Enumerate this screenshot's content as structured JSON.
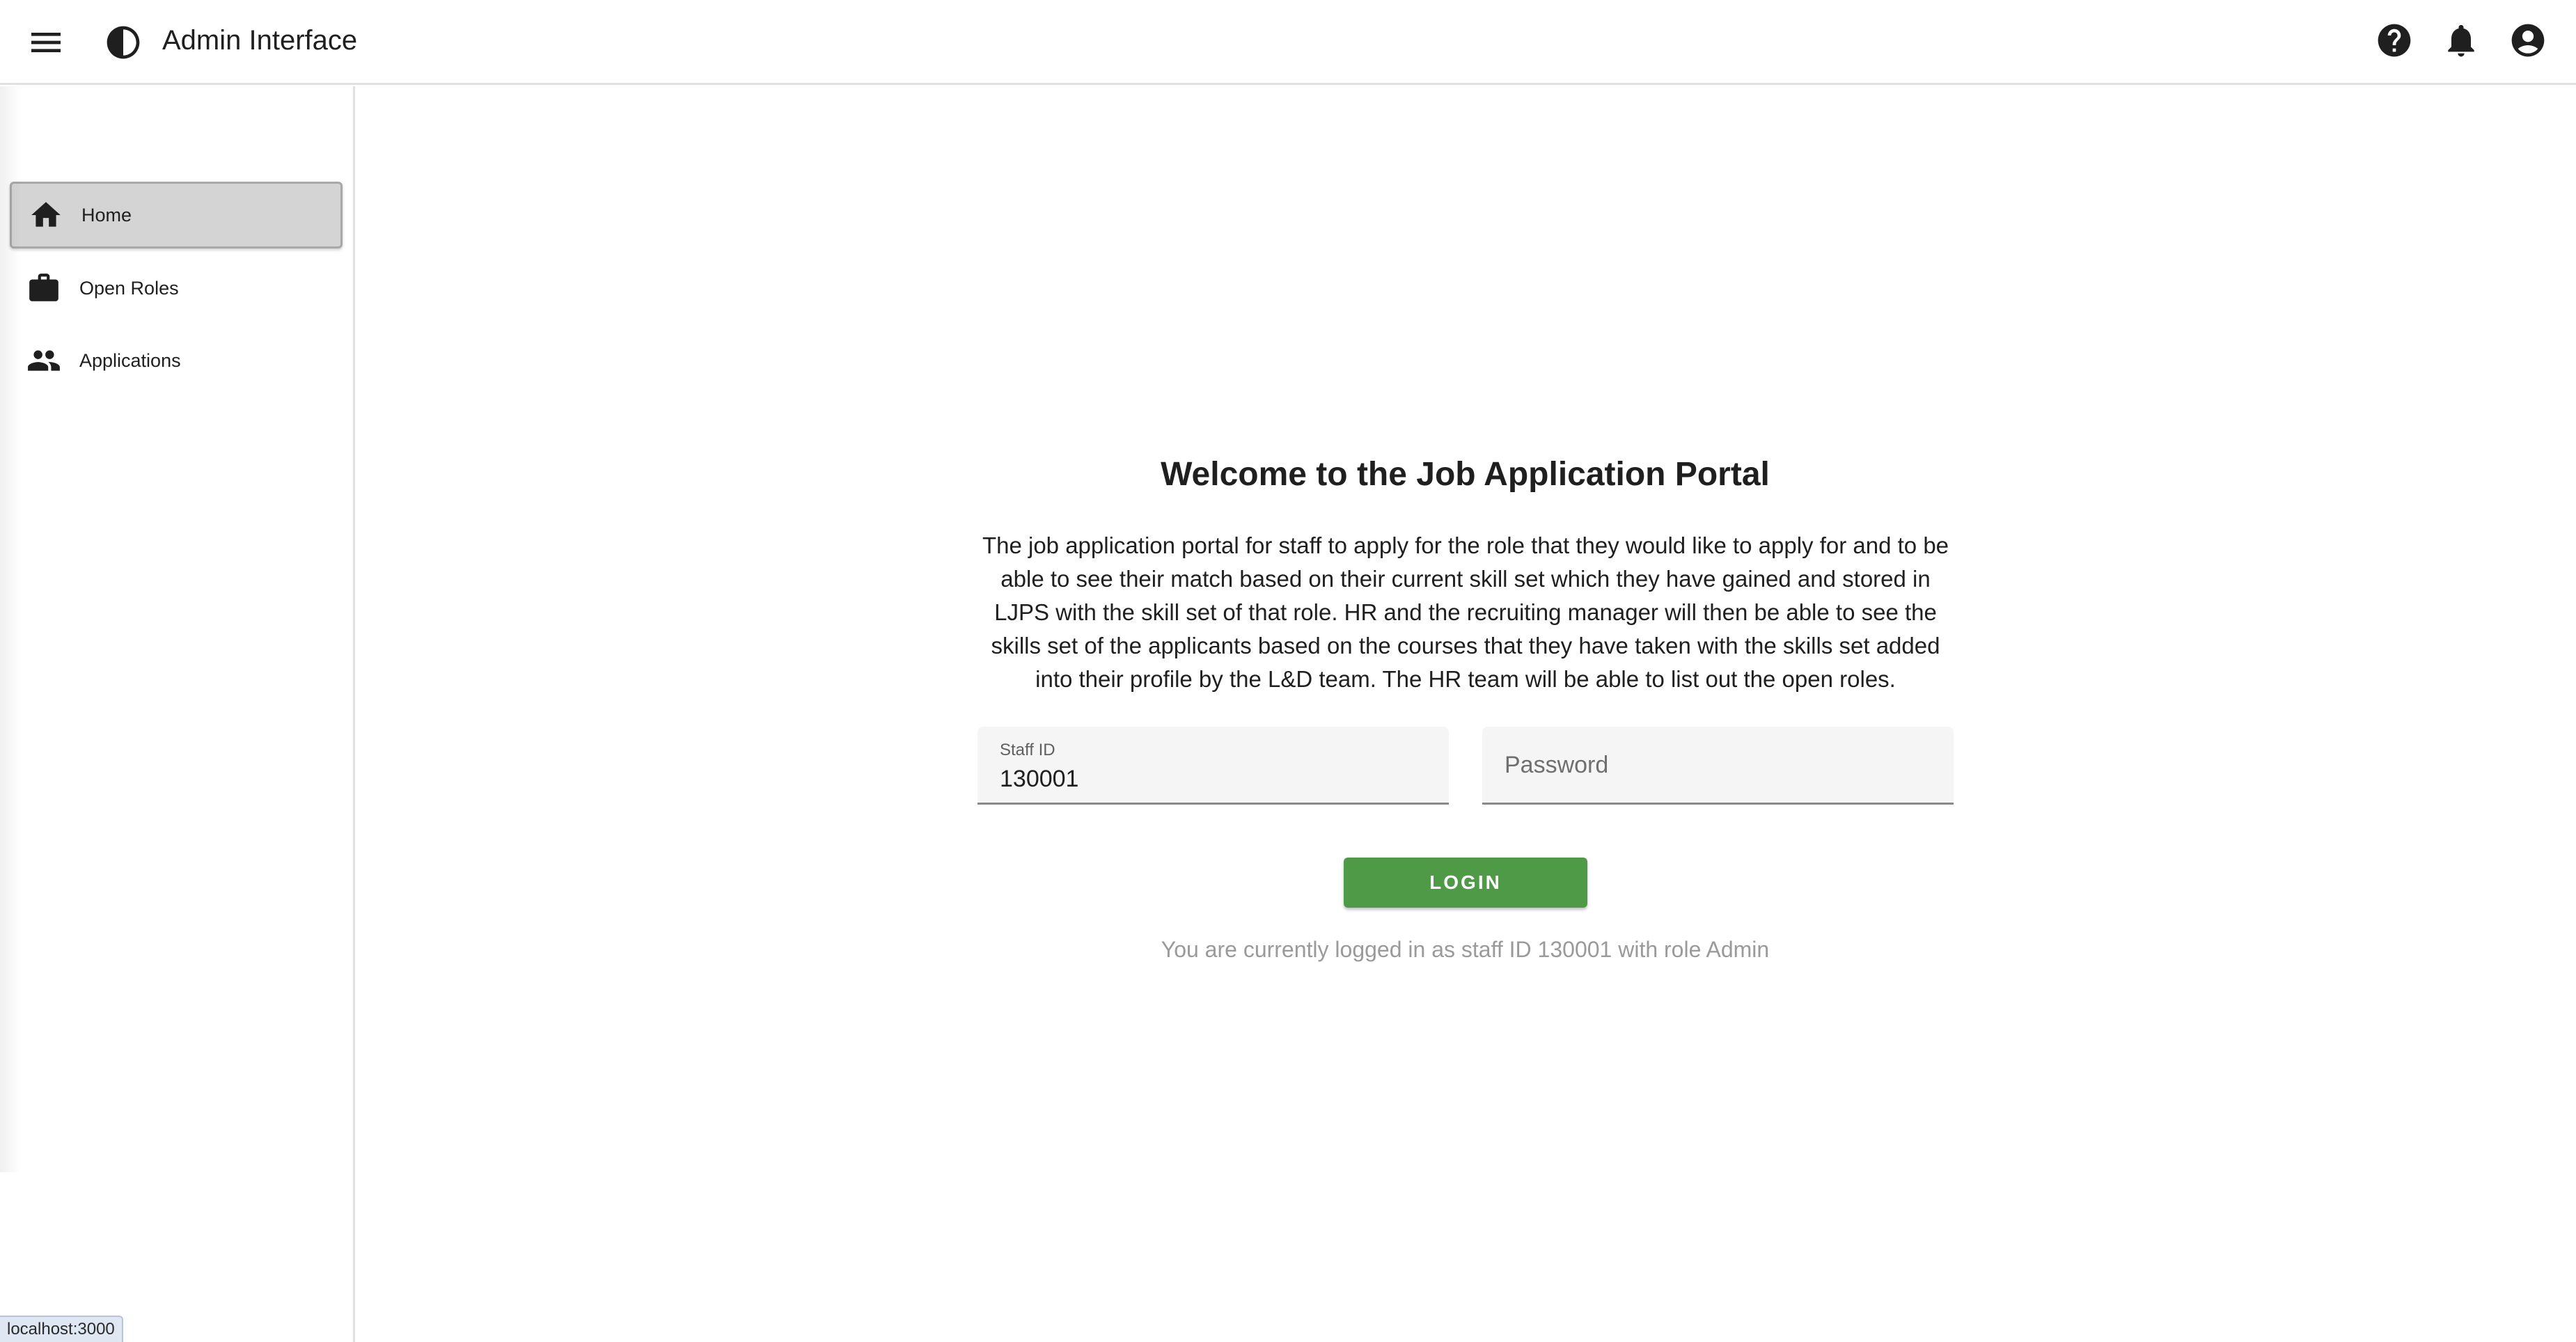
{
  "header": {
    "title": "Admin Interface",
    "icons": [
      "menu-icon",
      "contrast-icon",
      "help-icon",
      "bell-icon",
      "account-icon"
    ]
  },
  "sidebar": {
    "items": [
      {
        "label": "Home",
        "icon": "home-icon",
        "active": true
      },
      {
        "label": "Open Roles",
        "icon": "briefcase-icon",
        "active": false
      },
      {
        "label": "Applications",
        "icon": "people-icon",
        "active": false
      }
    ]
  },
  "main": {
    "heading": "Welcome to the Job Application Portal",
    "description": "The job application portal for staff to apply for the role that they would like to apply for and to be able to see their match based on their current skill set which they have gained and stored in LJPS with the skill set of that role. HR and the recruiting manager will then be able to see the skills set of the applicants based on the courses that they have taken with the skills set added into their profile by the L&D team. The HR team will be able to list out the open roles.",
    "staff_id": {
      "label": "Staff ID",
      "value": "130001"
    },
    "password": {
      "placeholder": "Password",
      "value": ""
    },
    "login_label": "LOGIN",
    "status": "You are currently logged in as staff ID 130001 with role Admin"
  },
  "browser": {
    "status_url": "localhost:3000"
  },
  "colors": {
    "accent": "#4f9a47",
    "active_nav": "#d4d4d4"
  }
}
